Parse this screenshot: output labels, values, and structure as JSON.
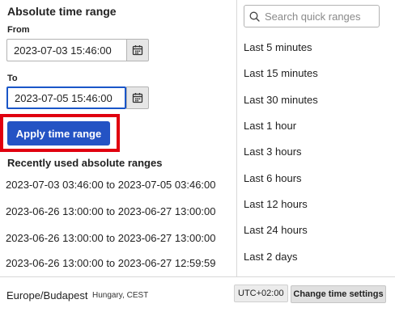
{
  "absolute": {
    "title": "Absolute time range",
    "from_label": "From",
    "from_value": "2023-07-03 15:46:00",
    "to_label": "To",
    "to_value": "2023-07-05 15:46:00",
    "calendar_icon": "calendar-icon",
    "apply_label": "Apply time range",
    "apply_color": "#2453c4",
    "highlight_color": "#e0000f"
  },
  "recent": {
    "title": "Recently used absolute ranges",
    "items": [
      "2023-07-03 03:46:00 to 2023-07-05 03:46:00",
      "2023-06-26 13:00:00 to 2023-06-27 13:00:00",
      "2023-06-26 13:00:00 to 2023-06-27 13:00:00",
      "2023-06-26 13:00:00 to 2023-06-27 12:59:59"
    ]
  },
  "quick": {
    "search_placeholder": "Search quick ranges",
    "search_icon": "search-icon",
    "items": [
      "Last 5 minutes",
      "Last 15 minutes",
      "Last 30 minutes",
      "Last 1 hour",
      "Last 3 hours",
      "Last 6 hours",
      "Last 12 hours",
      "Last 24 hours",
      "Last 2 days"
    ]
  },
  "footer": {
    "timezone": "Europe/Budapest",
    "timezone_desc": "Hungary, CEST",
    "utc_offset": "UTC+02:00",
    "change_label": "Change time settings"
  }
}
